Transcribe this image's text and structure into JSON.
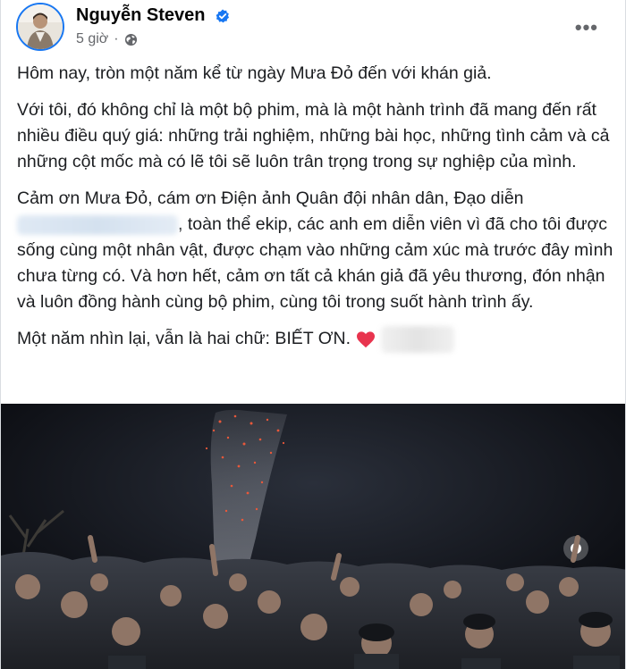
{
  "post": {
    "author_name": "Nguyễn Steven",
    "time_label": "5 giờ",
    "separator": "·",
    "more_label": "•••",
    "paragraphs": {
      "p1": "Hôm nay, tròn một năm kể từ ngày Mưa Đỏ đến với khán giả.",
      "p2": "Với tôi, đó không chỉ là một bộ phim, mà là một hành trình đã mang đến rất nhiều điều quý giá: những trải nghiệm, những bài học, những tình cảm và cả những cột mốc mà có lẽ tôi sẽ luôn trân trọng trong sự nghiệp của mình.",
      "p3a": "Cảm ơn Mưa Đỏ, cám ơn Điện ảnh Quân đội nhân dân, Đạo diễn",
      "p3b": ", toàn thể ekip, các anh em diễn viên vì đã cho tôi được sống cùng một nhân vật, được chạm vào những cảm xúc mà trước đây mình chưa từng có. Và hơn hết, cảm ơn tất cả khán giả đã yêu thương, đón nhận và luôn đồng hành cùng bộ phim, cùng tôi trong suốt hành trình ấy.",
      "p4": "Một năm nhìn lại, vẫn là hai chữ: BIẾT ƠN."
    },
    "icons": {
      "verified": "verified-badge-icon",
      "privacy": "globe-icon",
      "heart": "red-heart-emoji"
    },
    "colors": {
      "accent": "#1877f2",
      "heart": "#e8344e",
      "meta_text": "#65676b"
    }
  }
}
